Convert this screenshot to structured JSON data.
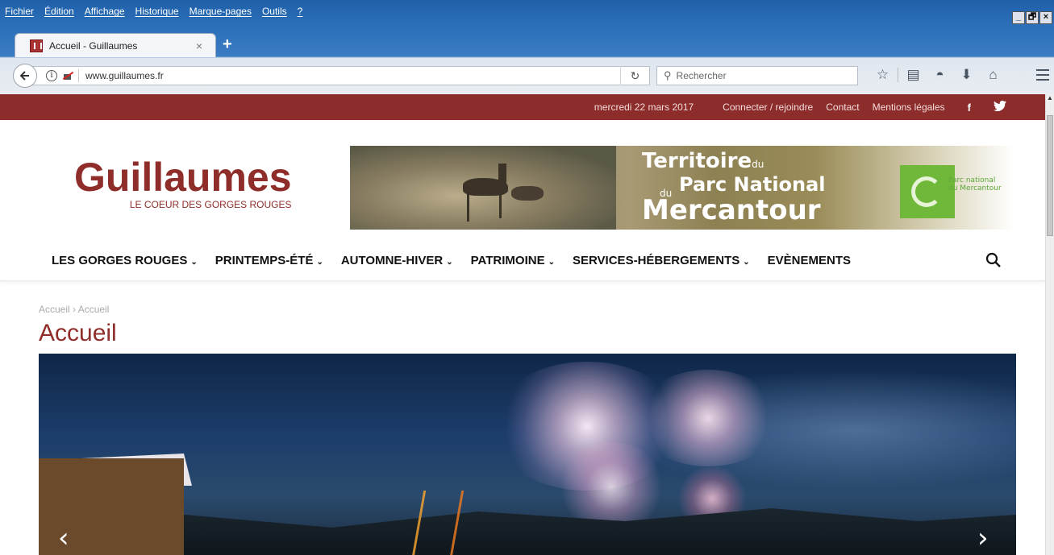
{
  "browser": {
    "menu": [
      "Fichier",
      "Édition",
      "Affichage",
      "Historique",
      "Marque-pages",
      "Outils",
      "?"
    ],
    "tab_title": "Accueil - Guillaumes",
    "tab_close": "×",
    "new_tab": "+",
    "url": "www.guillaumes.fr",
    "search_placeholder": "Rechercher",
    "window_buttons": [
      "_",
      "🗗",
      "×"
    ]
  },
  "topbar": {
    "date": "mercredi 22 mars 2017",
    "links": [
      "Connecter / rejoindre",
      "Contact",
      "Mentions légales"
    ],
    "social": [
      "f",
      "🐦"
    ]
  },
  "logo": {
    "title": "Guillaumes",
    "subtitle": "LE COEUR DES GORGES ROUGES"
  },
  "banner": {
    "line1": "Territoire",
    "line1_small": "du",
    "line2_small": "du",
    "line2": "Parc National",
    "line3": "Mercantour",
    "parc_text_1": "Parc national",
    "parc_text_2": "du Mercantour"
  },
  "nav": {
    "items": [
      "LES GORGES ROUGES",
      "PRINTEMPS-ÉTÉ",
      "AUTOMNE-HIVER",
      "PATRIMOINE",
      "SERVICES-HÉBERGEMENTS",
      "EVÈNEMENTS"
    ],
    "chevron": "⌄"
  },
  "breadcrumb": {
    "home": "Accueil",
    "separator": "›",
    "current": "Accueil"
  },
  "page": {
    "title": "Accueil"
  },
  "slider": {
    "prev": "‹",
    "next": "›"
  },
  "colors": {
    "brand_red": "#8f2d2a",
    "topbar_bg": "#8c2c2b"
  }
}
